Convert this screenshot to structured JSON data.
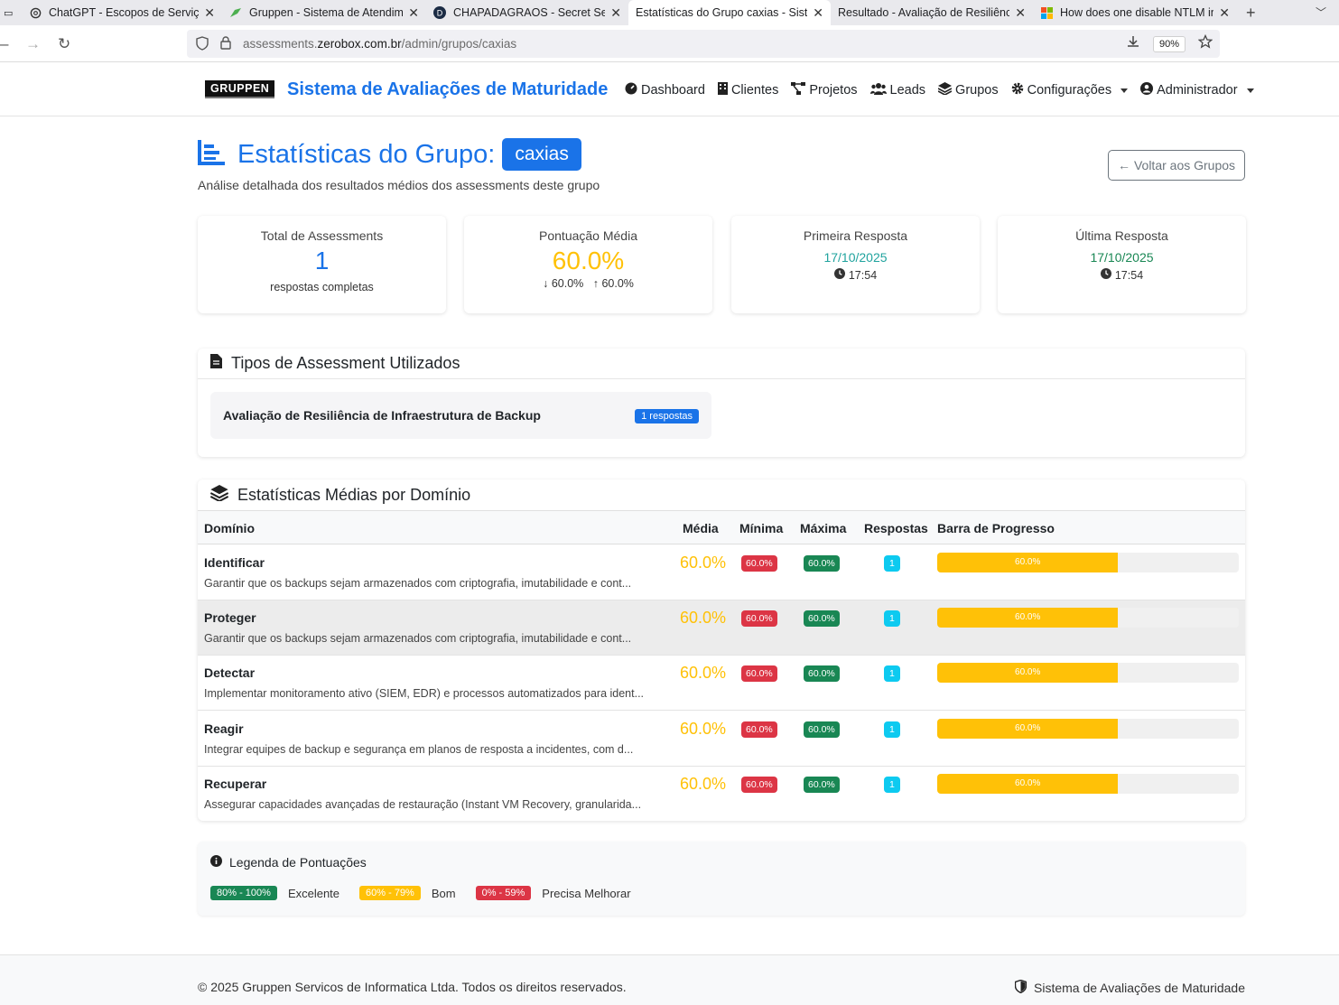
{
  "browser": {
    "tabs": [
      {
        "title": "ChatGPT - Escopos de Serviço"
      },
      {
        "title": "Gruppen - Sistema de Atendime"
      },
      {
        "title": "CHAPADAGRAOS - Secret Serve"
      },
      {
        "title": "Estatísticas do Grupo caxias - Sisten"
      },
      {
        "title": "Resultado - Avaliação de Resiliência"
      },
      {
        "title": "How does one disable NTLM in"
      }
    ],
    "url_prefix": "assessments.",
    "url_domain": "zerobox.com.br",
    "url_path": "/admin/grupos/caxias",
    "zoom": "90%"
  },
  "navbar": {
    "logo": "GRUPPEN",
    "brand": "Sistema de Avaliações de Maturidade",
    "items": [
      "Dashboard",
      "Clientes",
      "Projetos",
      "Leads",
      "Grupos",
      "Configurações",
      "Administrador"
    ]
  },
  "header": {
    "title": "Estatísticas do Grupo:",
    "group": "caxias",
    "subtitle": "Análise detalhada dos resultados médios dos assessments deste grupo",
    "back_label": "Voltar aos Grupos"
  },
  "stats": {
    "total": {
      "label": "Total de Assessments",
      "value": "1",
      "sub": "respostas completas"
    },
    "avg": {
      "label": "Pontuação Média",
      "value": "60.0%",
      "min": "60.0%",
      "max": "60.0%"
    },
    "first": {
      "label": "Primeira Resposta",
      "date": "17/10/2025",
      "time": "17:54"
    },
    "last": {
      "label": "Última Resposta",
      "date": "17/10/2025",
      "time": "17:54"
    }
  },
  "types": {
    "title": "Tipos de Assessment Utilizados",
    "items": [
      {
        "name": "Avaliação de Resiliência de Infraestrutura de Backup",
        "count": "1 respostas"
      }
    ]
  },
  "domains": {
    "title": "Estatísticas Médias por Domínio",
    "headers": [
      "Domínio",
      "Média",
      "Mínima",
      "Máxima",
      "Respostas",
      "Barra de Progresso"
    ],
    "rows": [
      {
        "name": "Identificar",
        "desc": "Garantir que os backups sejam armazenados com criptografia, imutabilidade e cont...",
        "avg": "60.0%",
        "min": "60.0%",
        "max": "60.0%",
        "count": "1",
        "progress": 60,
        "bar_label": "60.0%"
      },
      {
        "name": "Proteger",
        "desc": "Garantir que os backups sejam armazenados com criptografia, imutabilidade e cont...",
        "avg": "60.0%",
        "min": "60.0%",
        "max": "60.0%",
        "count": "1",
        "progress": 60,
        "bar_label": "60.0%"
      },
      {
        "name": "Detectar",
        "desc": "Implementar monitoramento ativo (SIEM, EDR) e processos automatizados para ident...",
        "avg": "60.0%",
        "min": "60.0%",
        "max": "60.0%",
        "count": "1",
        "progress": 60,
        "bar_label": "60.0%"
      },
      {
        "name": "Reagir",
        "desc": "Integrar equipes de backup e segurança em planos de resposta a incidentes, com d...",
        "avg": "60.0%",
        "min": "60.0%",
        "max": "60.0%",
        "count": "1",
        "progress": 60,
        "bar_label": "60.0%"
      },
      {
        "name": "Recuperar",
        "desc": "Assegurar capacidades avançadas de restauração (Instant VM Recovery, granularida...",
        "avg": "60.0%",
        "min": "60.0%",
        "max": "60.0%",
        "count": "1",
        "progress": 60,
        "bar_label": "60.0%"
      }
    ]
  },
  "legend": {
    "title": "Legenda de Pontuações",
    "items": [
      {
        "range": "80% - 100%",
        "label": "Excelente",
        "color": "#198754"
      },
      {
        "range": "60% - 79%",
        "label": "Bom",
        "color": "#ffc107"
      },
      {
        "range": "0% - 59%",
        "label": "Precisa Melhorar",
        "color": "#dc3545"
      }
    ]
  },
  "footer": {
    "copyright": "© 2025 Gruppen Servicos de Informatica Ltda. Todos os direitos reservados.",
    "right": "Sistema de Avaliações de Maturidade"
  },
  "colors": {
    "primary": "#1a73e8",
    "warning": "#ffc107",
    "success": "#198754",
    "danger": "#dc3545",
    "info": "#0dcaf0",
    "date_teal": "#20a39e",
    "date_green": "#198754"
  }
}
